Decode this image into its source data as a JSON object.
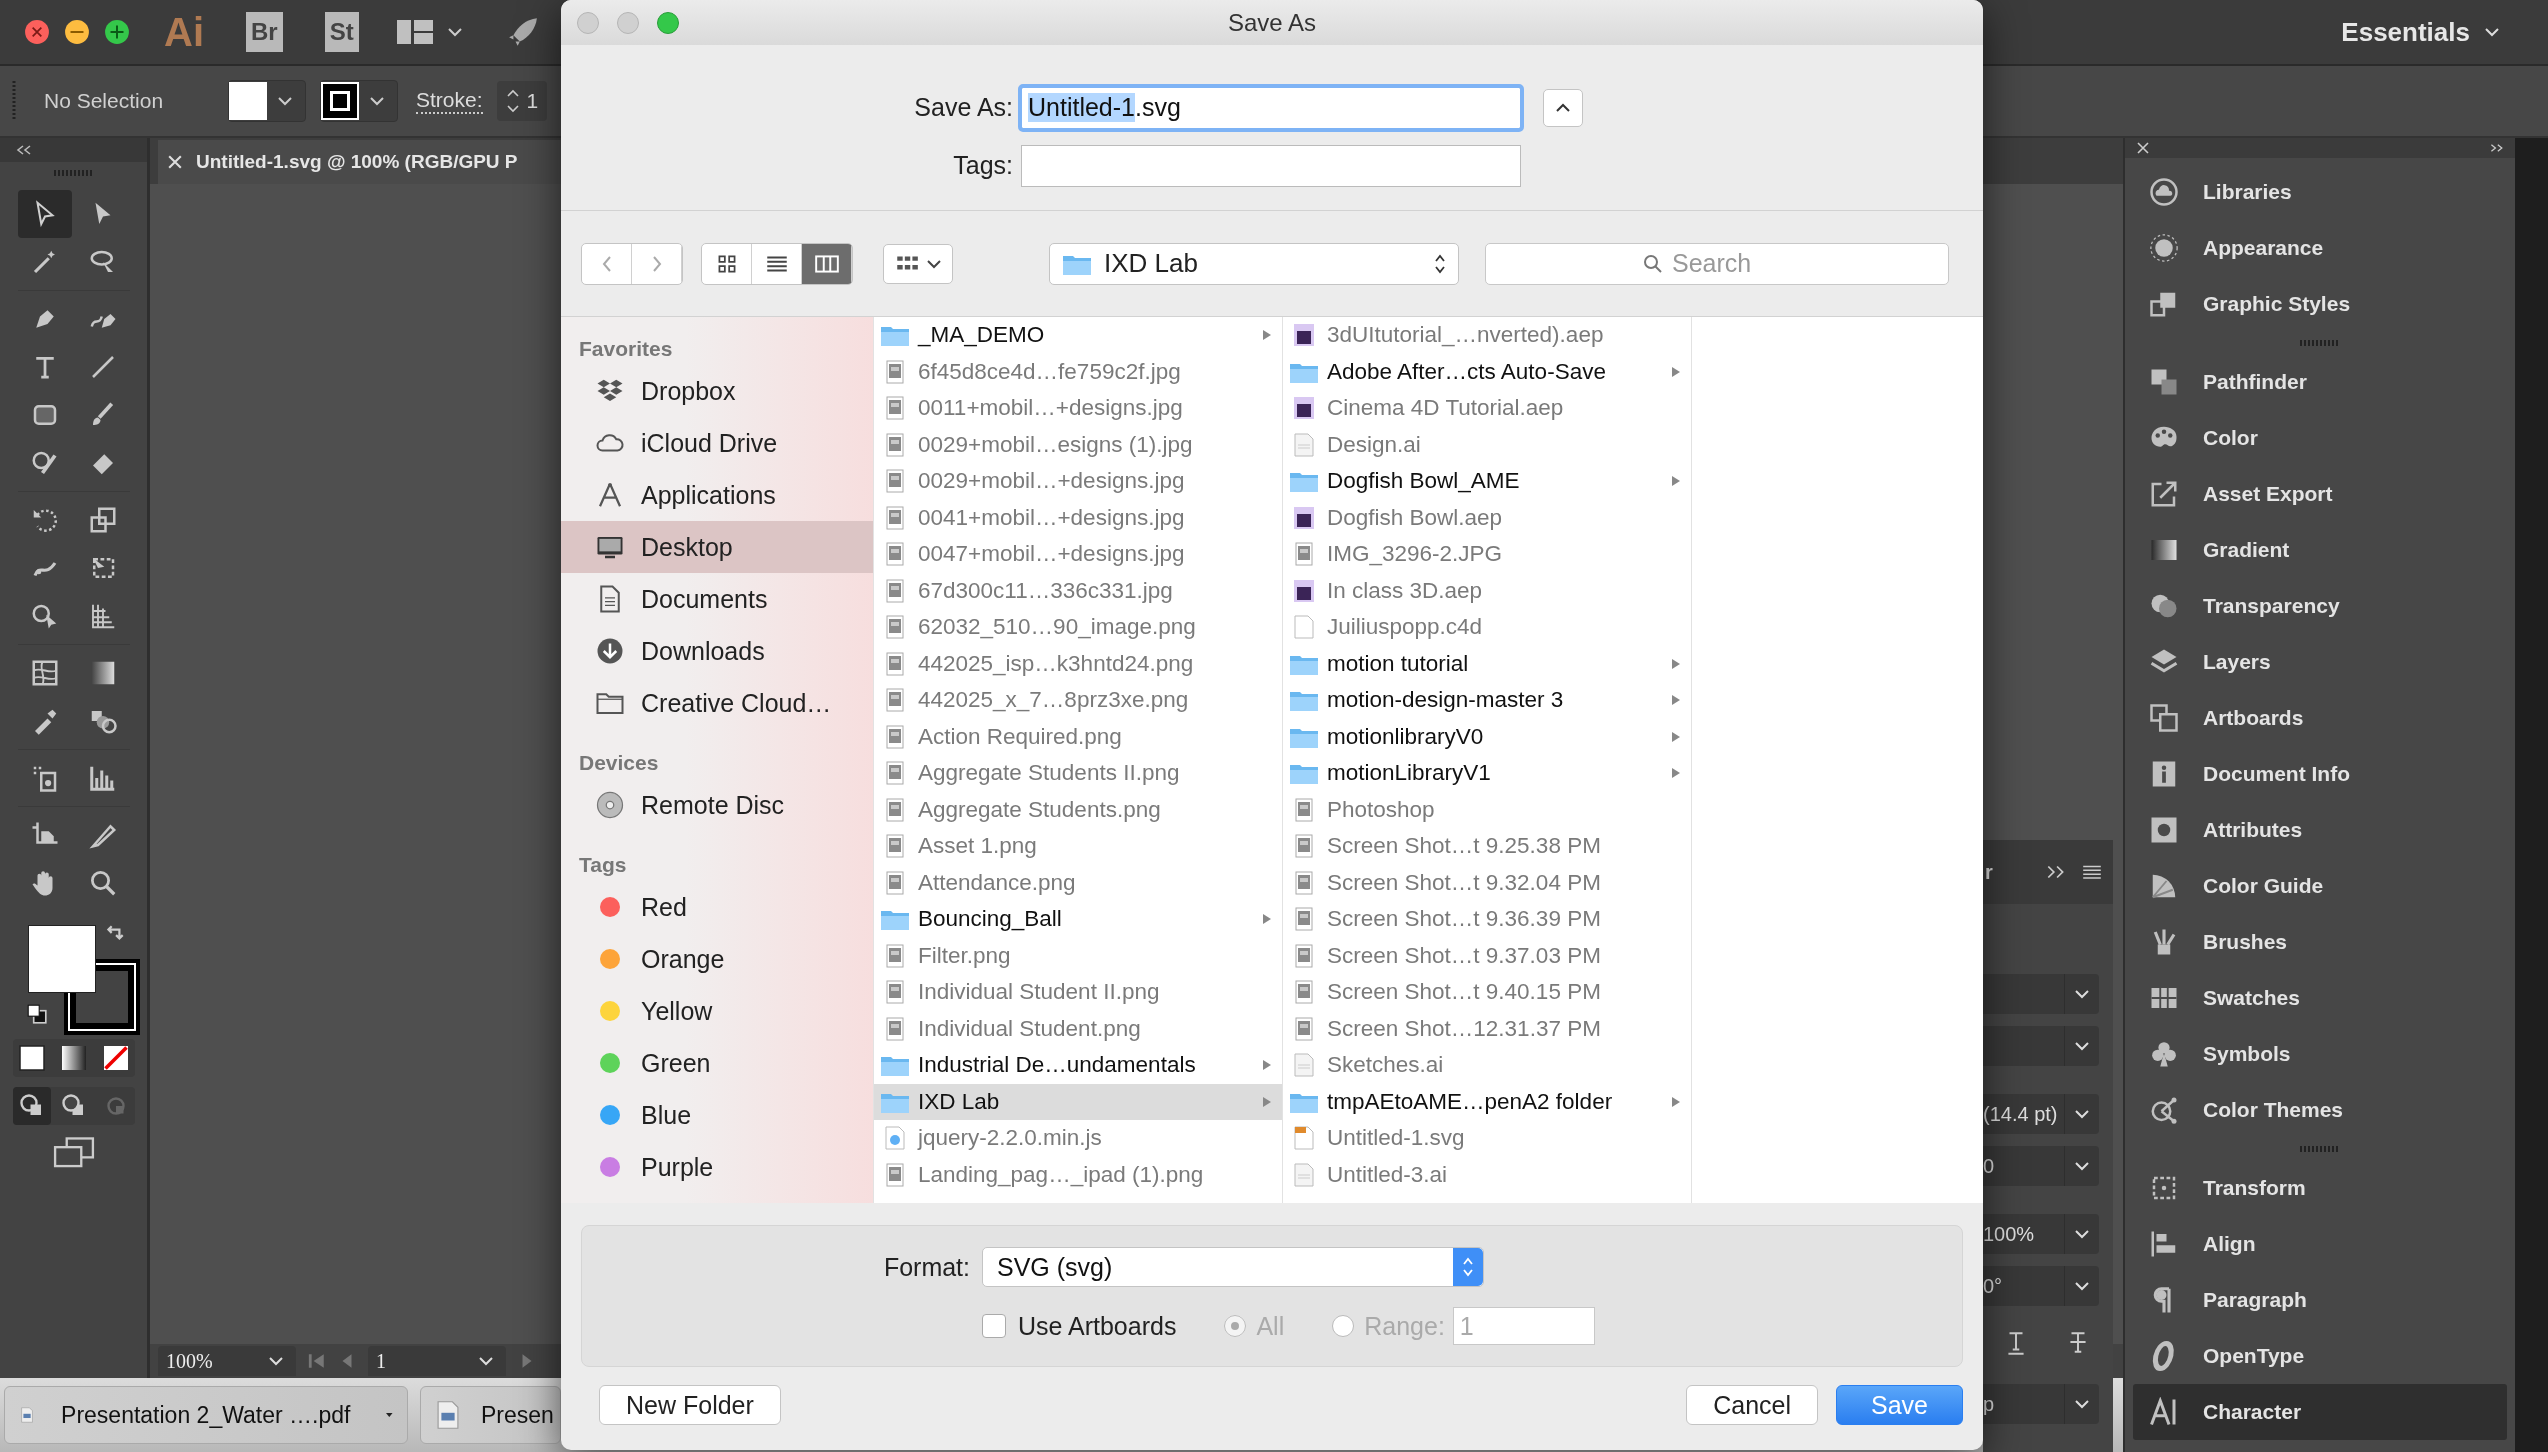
{
  "top_bar": {
    "logo": "Ai",
    "bridge": "Br",
    "stock": "St",
    "workspace": "Essentials"
  },
  "control_bar": {
    "selection": "No Selection",
    "stroke_label": "Stroke:",
    "stroke_value": "1"
  },
  "document_tab": {
    "title": "Untitled-1.svg @ 100% (RGB/GPU P"
  },
  "tools": [
    {
      "kind": "selection",
      "selected": true
    },
    {
      "kind": "direct",
      "selected": false
    },
    {
      "kind": "wand",
      "selected": false
    },
    {
      "kind": "lasso",
      "selected": false
    },
    {
      "kind": "pen",
      "selected": false
    },
    {
      "kind": "curvature",
      "selected": false
    },
    {
      "kind": "type",
      "selected": false
    },
    {
      "kind": "line",
      "selected": false
    },
    {
      "kind": "rect",
      "selected": false
    },
    {
      "kind": "brush",
      "selected": false
    },
    {
      "kind": "shaper",
      "selected": false
    },
    {
      "kind": "eraser",
      "selected": false
    },
    {
      "kind": "rotate",
      "selected": false
    },
    {
      "kind": "scale",
      "selected": false
    },
    {
      "kind": "warp",
      "selected": false
    },
    {
      "kind": "freetransform",
      "selected": false
    },
    {
      "kind": "shapebuilder",
      "selected": false
    },
    {
      "kind": "perspective",
      "selected": false
    },
    {
      "kind": "mesh",
      "selected": false
    },
    {
      "kind": "gradient",
      "selected": false
    },
    {
      "kind": "eyedropper",
      "selected": false
    },
    {
      "kind": "blend",
      "selected": false
    },
    {
      "kind": "sprayer",
      "selected": false
    },
    {
      "kind": "graph",
      "selected": false
    },
    {
      "kind": "artboard",
      "selected": false
    },
    {
      "kind": "slice",
      "selected": false
    },
    {
      "kind": "hand",
      "selected": false
    },
    {
      "kind": "zoom",
      "selected": false
    }
  ],
  "status_bar": {
    "zoom": "100%",
    "artboard": "1"
  },
  "downloads": [
    {
      "label": "Presentation 2_Water ….pdf"
    },
    {
      "label": "Presen"
    }
  ],
  "panel_groups": [
    {
      "items": [
        {
          "label": "Libraries",
          "selected": false
        },
        {
          "label": "Appearance",
          "selected": false
        },
        {
          "label": "Graphic Styles",
          "selected": false
        }
      ]
    },
    {
      "items": [
        {
          "label": "Pathfinder",
          "selected": false
        },
        {
          "label": "Color",
          "selected": false
        },
        {
          "label": "Asset Export",
          "selected": false
        },
        {
          "label": "Gradient",
          "selected": false
        },
        {
          "label": "Transparency",
          "selected": false
        },
        {
          "label": "Layers",
          "selected": false
        },
        {
          "label": "Artboards",
          "selected": false
        },
        {
          "label": "Document Info",
          "selected": false
        },
        {
          "label": "Attributes",
          "selected": false
        },
        {
          "label": "Color Guide",
          "selected": false
        },
        {
          "label": "Brushes",
          "selected": false
        },
        {
          "label": "Swatches",
          "selected": false
        },
        {
          "label": "Symbols",
          "selected": false
        },
        {
          "label": "Color Themes",
          "selected": false
        }
      ]
    },
    {
      "items": [
        {
          "label": "Transform",
          "selected": false
        },
        {
          "label": "Align",
          "selected": false
        },
        {
          "label": "Paragraph",
          "selected": false
        },
        {
          "label": "OpenType",
          "selected": false
        },
        {
          "label": "Character",
          "selected": true
        }
      ]
    }
  ],
  "character_panel": {
    "title": "r",
    "fields": [
      {
        "kind": "dropdown"
      },
      {
        "kind": "dropdown"
      },
      {
        "kind": "dropdown",
        "value": "(14.4 pt)"
      },
      {
        "kind": "dropdown",
        "value": "0"
      },
      {
        "kind": "dropdown",
        "value": "100%"
      },
      {
        "kind": "dropdown",
        "value": "0°"
      },
      {
        "kind": "buttons"
      },
      {
        "kind": "dropdown",
        "value": "p"
      }
    ]
  },
  "dialog": {
    "title": "Save As",
    "save_as": {
      "label": "Save As:",
      "selected_text": "Untitled-1",
      "rest_text": ".svg"
    },
    "tags": {
      "label": "Tags:"
    },
    "views": [
      {
        "kind": "icon",
        "selected": false
      },
      {
        "kind": "list",
        "selected": false
      },
      {
        "kind": "column",
        "selected": true
      }
    ],
    "location": "IXD Lab",
    "search": {
      "placeholder": "Search"
    },
    "sidebar": [
      {
        "heading": "Favorites",
        "items": [
          {
            "label": "Dropbox",
            "kind": "dropbox",
            "selected": false
          },
          {
            "label": "iCloud Drive",
            "kind": "cloud",
            "selected": false
          },
          {
            "label": "Applications",
            "kind": "apps",
            "selected": false
          },
          {
            "label": "Desktop",
            "kind": "desktop",
            "selected": true
          },
          {
            "label": "Documents",
            "kind": "documents",
            "selected": false
          },
          {
            "label": "Downloads",
            "kind": "downloads",
            "selected": false
          },
          {
            "label": "Creative Cloud…",
            "kind": "folder",
            "selected": false
          }
        ]
      },
      {
        "heading": "Devices",
        "items": [
          {
            "label": "Remote Disc",
            "kind": "disc",
            "selected": false
          }
        ]
      },
      {
        "heading": "Tags",
        "items": [
          {
            "label": "Red",
            "kind": "tag",
            "color": "#fc605c",
            "selected": false
          },
          {
            "label": "Orange",
            "kind": "tag",
            "color": "#fda43a",
            "selected": false
          },
          {
            "label": "Yellow",
            "kind": "tag",
            "color": "#fdd43c",
            "selected": false
          },
          {
            "label": "Green",
            "kind": "tag",
            "color": "#5ed35a",
            "selected": false
          },
          {
            "label": "Blue",
            "kind": "tag",
            "color": "#37a6f6",
            "selected": false
          },
          {
            "label": "Purple",
            "kind": "tag",
            "color": "#c97de3",
            "selected": false
          }
        ]
      }
    ],
    "columns": [
      {
        "items": [
          {
            "name": "_MA_DEMO",
            "kind": "folder",
            "disabled": false,
            "selected": false
          },
          {
            "name": "6f45d8ce4d…fe759c2f.jpg",
            "kind": "image",
            "disabled": true,
            "selected": false
          },
          {
            "name": "0011+mobil…+designs.jpg",
            "kind": "image",
            "disabled": true,
            "selected": false
          },
          {
            "name": "0029+mobil…esigns (1).jpg",
            "kind": "image",
            "disabled": true,
            "selected": false
          },
          {
            "name": "0029+mobil…+designs.jpg",
            "kind": "image",
            "disabled": true,
            "selected": false
          },
          {
            "name": "0041+mobil…+designs.jpg",
            "kind": "image",
            "disabled": true,
            "selected": false
          },
          {
            "name": "0047+mobil…+designs.jpg",
            "kind": "image",
            "disabled": true,
            "selected": false
          },
          {
            "name": "67d300c11…336c331.jpg",
            "kind": "image",
            "disabled": true,
            "selected": false
          },
          {
            "name": "62032_510…90_image.png",
            "kind": "image",
            "disabled": true,
            "selected": false
          },
          {
            "name": "442025_isp…k3hntd24.png",
            "kind": "image",
            "disabled": true,
            "selected": false
          },
          {
            "name": "442025_x_7…8prz3xe.png",
            "kind": "image",
            "disabled": true,
            "selected": false
          },
          {
            "name": "Action Required.png",
            "kind": "image",
            "disabled": true,
            "selected": false
          },
          {
            "name": "Aggregate Students II.png",
            "kind": "image",
            "disabled": true,
            "selected": false
          },
          {
            "name": "Aggregate Students.png",
            "kind": "image",
            "disabled": true,
            "selected": false
          },
          {
            "name": "Asset 1.png",
            "kind": "image",
            "disabled": true,
            "selected": false
          },
          {
            "name": "Attendance.png",
            "kind": "image",
            "disabled": true,
            "selected": false
          },
          {
            "name": "Bouncing_Ball",
            "kind": "folder",
            "disabled": false,
            "selected": false
          },
          {
            "name": "Filter.png",
            "kind": "image",
            "disabled": true,
            "selected": false
          },
          {
            "name": "Individual Student II.png",
            "kind": "image",
            "disabled": true,
            "selected": false
          },
          {
            "name": "Individual Student.png",
            "kind": "image",
            "disabled": true,
            "selected": false
          },
          {
            "name": "Industrial De…undamentals",
            "kind": "folder",
            "disabled": false,
            "selected": false
          },
          {
            "name": "IXD Lab",
            "kind": "folder",
            "disabled": false,
            "selected": true
          },
          {
            "name": "jquery-2.2.0.min.js",
            "kind": "script",
            "disabled": true,
            "selected": false
          },
          {
            "name": "Landing_pag…_ipad (1).png",
            "kind": "image",
            "disabled": true,
            "selected": false
          }
        ]
      },
      {
        "items": [
          {
            "name": "3dUItutorial_…nverted).aep",
            "kind": "project",
            "disabled": true,
            "selected": false
          },
          {
            "name": "Adobe After…cts Auto-Save",
            "kind": "folder",
            "disabled": false,
            "selected": false
          },
          {
            "name": "Cinema 4D Tutorial.aep",
            "kind": "project",
            "disabled": true,
            "selected": false
          },
          {
            "name": "Design.ai",
            "kind": "document",
            "disabled": true,
            "selected": false
          },
          {
            "name": "Dogfish Bowl_AME",
            "kind": "folder",
            "disabled": false,
            "selected": false
          },
          {
            "name": "Dogfish Bowl.aep",
            "kind": "project",
            "disabled": true,
            "selected": false
          },
          {
            "name": "IMG_3296-2.JPG",
            "kind": "image",
            "disabled": true,
            "selected": false
          },
          {
            "name": "In class 3D.aep",
            "kind": "project",
            "disabled": true,
            "selected": false
          },
          {
            "name": "Juiliuspopp.c4d",
            "kind": "blank",
            "disabled": true,
            "selected": false
          },
          {
            "name": "motion tutorial",
            "kind": "folder",
            "disabled": false,
            "selected": false
          },
          {
            "name": "motion-design-master 3",
            "kind": "folder",
            "disabled": false,
            "selected": false
          },
          {
            "name": "motionlibraryV0",
            "kind": "folder",
            "disabled": false,
            "selected": false
          },
          {
            "name": "motionLibraryV1",
            "kind": "folder",
            "disabled": false,
            "selected": false
          },
          {
            "name": "Photoshop",
            "kind": "image",
            "disabled": true,
            "selected": false
          },
          {
            "name": "Screen Shot…t 9.25.38 PM",
            "kind": "image",
            "disabled": true,
            "selected": false
          },
          {
            "name": "Screen Shot…t 9.32.04 PM",
            "kind": "image",
            "disabled": true,
            "selected": false
          },
          {
            "name": "Screen Shot…t 9.36.39 PM",
            "kind": "image",
            "disabled": true,
            "selected": false
          },
          {
            "name": "Screen Shot…t 9.37.03 PM",
            "kind": "image",
            "disabled": true,
            "selected": false
          },
          {
            "name": "Screen Shot…t 9.40.15 PM",
            "kind": "image",
            "disabled": true,
            "selected": false
          },
          {
            "name": "Screen Shot…12.31.37 PM",
            "kind": "image",
            "disabled": true,
            "selected": false
          },
          {
            "name": "Sketches.ai",
            "kind": "document",
            "disabled": true,
            "selected": false
          },
          {
            "name": "tmpAEtoAME…penA2 folder",
            "kind": "folder",
            "disabled": false,
            "selected": false
          },
          {
            "name": "Untitled-1.svg",
            "kind": "vector",
            "disabled": true,
            "selected": false
          },
          {
            "name": "Untitled-3.ai",
            "kind": "document",
            "disabled": true,
            "selected": false
          }
        ]
      }
    ],
    "format": {
      "label": "Format:",
      "value": "SVG (svg)"
    },
    "use_artboards": {
      "label": "Use Artboards",
      "checked": false
    },
    "range_options": [
      {
        "label": "All",
        "selected": true,
        "disabled": true
      },
      {
        "label": "Range:",
        "selected": false,
        "disabled": true
      }
    ],
    "range_field": {
      "value": "1",
      "disabled": true
    },
    "buttons": [
      {
        "label": "New Folder",
        "kind": "secondary"
      },
      {
        "label": "Cancel",
        "kind": "secondary"
      },
      {
        "label": "Save",
        "kind": "default"
      }
    ]
  }
}
